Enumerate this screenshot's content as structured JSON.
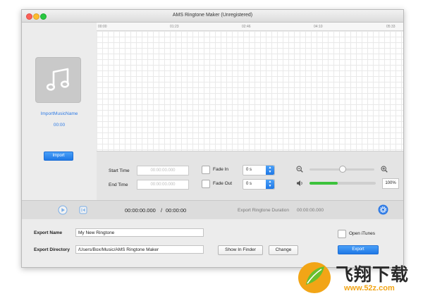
{
  "window": {
    "title": "AMS Ringtone Maker (Unregistered)"
  },
  "sidebar": {
    "music_name": "ImportMusicName",
    "music_time": "00:00",
    "import_label": "Import"
  },
  "timeline": {
    "ticks": [
      "00:00",
      "01:23",
      "02:46",
      "04:10",
      "05:33"
    ]
  },
  "settings": {
    "start_time_label": "Start Time",
    "start_time_placeholder": "00:00:00.000",
    "end_time_label": "End Time",
    "end_time_placeholder": "00:00:00.000",
    "fade_in_label": "Fade In",
    "fade_in_value": "0 s",
    "fade_out_label": "Fade Out",
    "fade_out_value": "0 s",
    "zoom_level": 0.5,
    "volume_level": 0.43,
    "volume_percent": "100%"
  },
  "playback": {
    "current_time": "00:00:00.000",
    "total_time": "00:00:00",
    "separator": "/",
    "duration_label": "Export Ringtone Duration",
    "duration_value": "00:00:00.000"
  },
  "export": {
    "name_label": "Export Name",
    "name_value": "My New Ringtone",
    "dir_label": "Export Directory",
    "dir_value": "/Users/Box/Music/AMS Ringtone Maker",
    "show_in_finder_label": "Show In Finder",
    "change_label": "Change",
    "open_itunes_label": "Open iTunes",
    "export_label": "Export"
  },
  "watermark": {
    "brand": "飞翔下载",
    "url": "www.52z.com"
  },
  "colors": {
    "accent": "#2f7be5",
    "volume_fill": "#3cc23c",
    "close": "#fc5f57",
    "minimize": "#fdbc2e",
    "zoom": "#28c840"
  }
}
